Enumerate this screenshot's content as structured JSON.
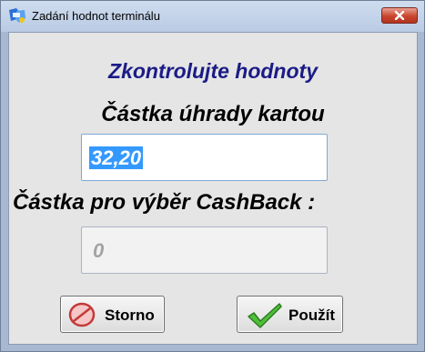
{
  "window": {
    "title": "Zadání hodnot terminálu",
    "icons": {
      "app": "terminal-app-icon",
      "close": "close-icon"
    }
  },
  "form": {
    "check_heading": "Zkontrolujte hodnoty",
    "amount_label": "Částka úhrady kartou",
    "amount_value": "32,20",
    "cashback_label": "Částka pro výběr CashBack :",
    "cashback_value": "0"
  },
  "buttons": {
    "cancel_label": "Storno",
    "cancel_icon": "no-entry-icon",
    "apply_label": "Použít",
    "apply_icon": "checkmark-icon"
  },
  "colors": {
    "heading": "#1b1b86",
    "selection": "#3399ff",
    "close_button": "#c9452e",
    "dialog_background": "#e5e5e5"
  }
}
